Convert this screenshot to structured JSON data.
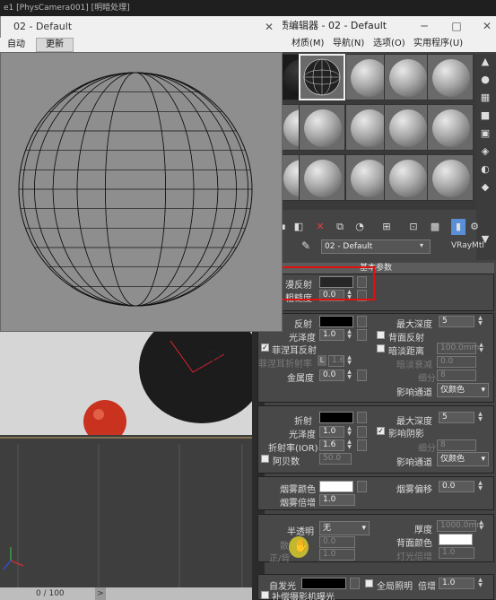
{
  "top_strip": {
    "text": "e1 [PhysCamera001] [明暗处理]"
  },
  "material_editor": {
    "title": "质编辑器 - 02 - Default",
    "window_buttons": [
      "─",
      "□",
      "✕"
    ],
    "menu": [
      "材质(M)",
      "导航(N)",
      "选项(O)",
      "实用程序(U)"
    ],
    "material_name": "02 - Default",
    "material_type": "VRayMtl",
    "rollout_title": "基本参数"
  },
  "preview_window": {
    "title": "02 - Default",
    "close_symbol": "✕",
    "menu": [
      "自动",
      "更新"
    ]
  },
  "diffuse_group": {
    "diffuse_label": "漫反射",
    "roughness_label": "粗糙度",
    "roughness_value": "0.0"
  },
  "reflection_group": {
    "reflect_label": "反射",
    "glossiness_label": "光泽度",
    "glossiness_value": "1.0",
    "fresnel_label": "菲涅耳反射",
    "fresnel_ior_label": "菲涅耳折射率",
    "fresnel_ior_lock": "L",
    "fresnel_ior_value": "1.6",
    "metalness_label": "金属度",
    "metalness_value": "0.0",
    "max_depth_label": "最大深度",
    "max_depth_value": "5",
    "back_reflect_label": "背面反射",
    "dim_distance_label": "暗淡距离",
    "dim_distance_value": "100.0mm",
    "dim_falloff_label": "暗淡衰减",
    "dim_falloff_value": "0.0",
    "subdivs_label": "细分",
    "subdivs_value": "8",
    "affect_channels_label": "影响通道",
    "affect_channels_value": "仅颜色"
  },
  "refraction_group": {
    "refract_label": "折射",
    "glossiness_label": "光泽度",
    "glossiness_value": "1.0",
    "ior_label": "折射率(IOR)",
    "ior_value": "1.6",
    "abbe_label": "阿贝数",
    "abbe_value": "50.0",
    "max_depth_label": "最大深度",
    "max_depth_value": "5",
    "affect_shadows_label": "影响阴影",
    "subdivs_label": "细分",
    "subdivs_value": "8",
    "affect_channels_label": "影响通道",
    "affect_channels_value": "仅颜色"
  },
  "fog_group": {
    "fog_color_label": "烟雾颜色",
    "fog_mult_label": "烟雾倍增",
    "fog_mult_value": "1.0",
    "fog_bias_label": "烟雾偏移",
    "fog_bias_value": "0.0"
  },
  "translucency_group": {
    "translucency_label": "半透明",
    "translucency_value": "无",
    "scatter_label": "散",
    "scatter_value": "0.0",
    "fwd_back_label": "正/背",
    "fwd_back_value": "1.0",
    "thickness_label": "厚度",
    "thickness_value": "1000.0mm",
    "back_color_label": "背面颜色",
    "light_mult_label": "灯光倍增",
    "light_mult_value": "1.0"
  },
  "self_illum_group": {
    "self_illum_label": "自发光",
    "gi_label": "全局照明",
    "mult_label": "倍增",
    "mult_value": "1.0",
    "compensate_label": "补偿摄影机曝光"
  },
  "timeline": {
    "frame": "0 / 100",
    "arrow": ">"
  },
  "colors": {
    "highlight_red": "#e01010",
    "diffuse_swatch": "#262626",
    "reflect_swatch": "#000000",
    "refract_swatch": "#000000",
    "fog_swatch": "#ffffff",
    "back_color_swatch": "#ffffff",
    "self_illum_swatch": "#000000",
    "red_ball": "#c8321e"
  }
}
